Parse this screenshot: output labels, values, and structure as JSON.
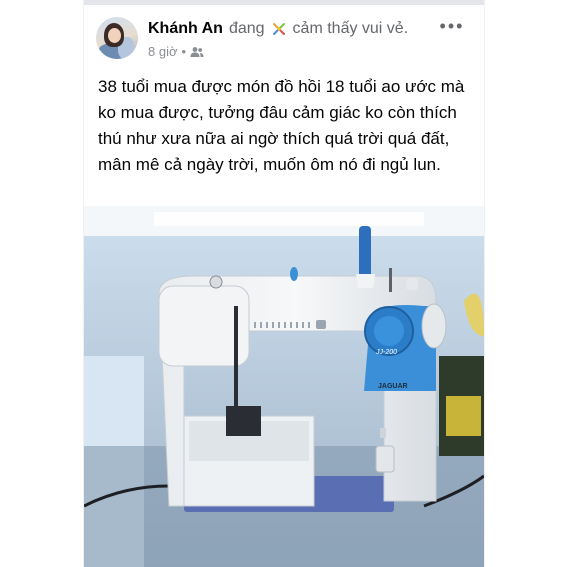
{
  "post": {
    "author": "Khánh An",
    "activity_word": "đang",
    "feeling_text": "cảm thấy vui vẻ.",
    "feeling_icon": "confetti-icon",
    "timestamp": "8 giờ",
    "separator": "•",
    "audience_icon": "friends-icon",
    "more_icon": "more-options-icon",
    "more_label": "•••",
    "text": "38 tuổi mua được món đồ hồi 18 tuổi ao ước mà ko mua được, tưởng đâu cảm giác ko còn thích thú như xưa nữa ai ngờ thích quá trời quá đất, mân mê cả ngày trời, muốn ôm nó đi ngủ lun.",
    "photo": {
      "subject": "sewing-machine",
      "brand_label": "JAGUAR"
    }
  },
  "colors": {
    "author": "#050505",
    "secondary_text": "#65676b",
    "machine_accent": "#2f8fdc"
  }
}
